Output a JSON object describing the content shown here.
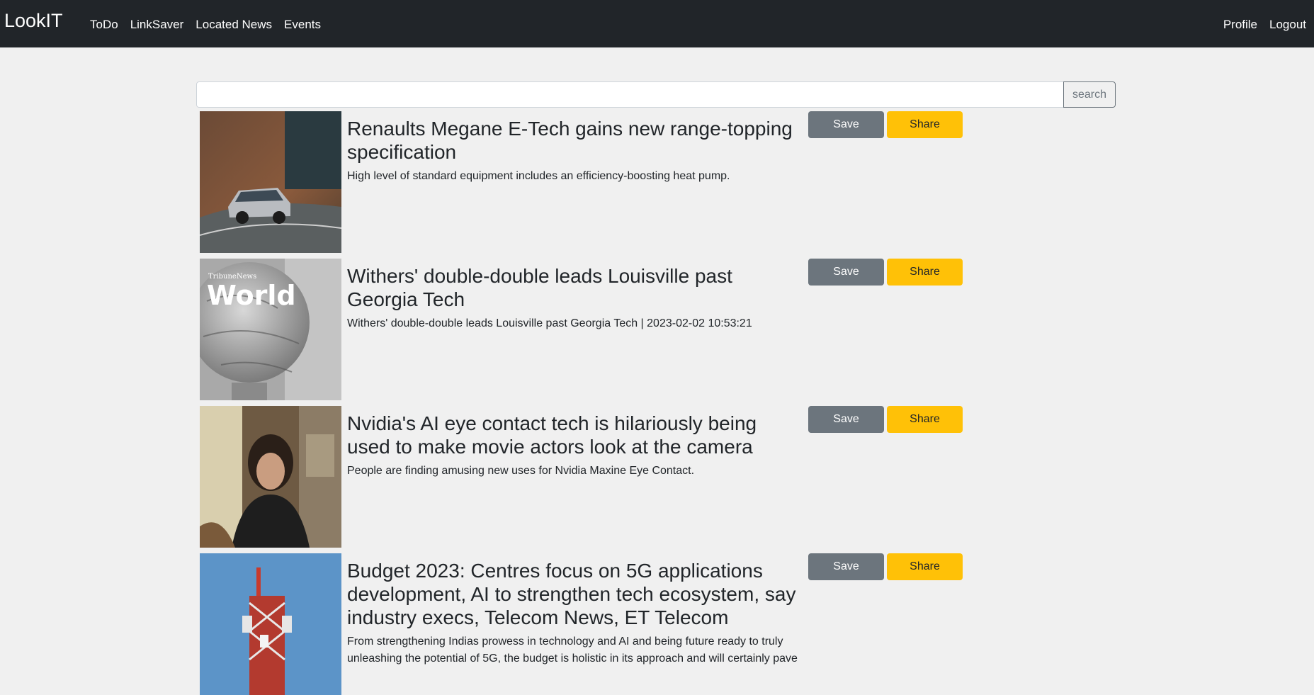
{
  "nav": {
    "brand": "LookIT",
    "left_links": [
      "ToDo",
      "LinkSaver",
      "Located News",
      "Events"
    ],
    "right_links": [
      "Profile",
      "Logout"
    ]
  },
  "search": {
    "value": "",
    "placeholder": "",
    "button_label": "search"
  },
  "articles": [
    {
      "title": "Renaults Megane E-Tech gains new range-topping specification",
      "description": "High level of standard equipment includes an efficiency-boosting heat pump.",
      "image": "car-on-mountain-road",
      "save_label": "Save",
      "share_label": "Share"
    },
    {
      "title": "Withers' double-double leads Louisville past Georgia Tech",
      "description": "Withers' double-double leads Louisville past Georgia Tech | 2023-02-02 10:53:21",
      "image": "world-globe",
      "image_text_small": "TribuneNews",
      "image_text_big": "World",
      "save_label": "Save",
      "share_label": "Share"
    },
    {
      "title": "Nvidia's AI eye contact tech is hilariously being used to make movie actors look at the camera",
      "description": "People are finding amusing new uses for Nvidia Maxine Eye Contact.",
      "image": "movie-actor",
      "save_label": "Save",
      "share_label": "Share"
    },
    {
      "title": "Budget 2023: Centres focus on 5G applications development, AI to strengthen tech ecosystem, say industry execs, Telecom News, ET Telecom",
      "description": "From strengthening Indias prowess in technology and AI and being future ready to truly unleashing the potential of 5G, the budget is holistic in its approach and will certainly pave",
      "image": "telecom-tower",
      "save_label": "Save",
      "share_label": "Share"
    }
  ],
  "colors": {
    "navbar": "#212529",
    "background": "#f0f0f0",
    "save_button": "#6c757d",
    "share_button": "#ffc107"
  }
}
